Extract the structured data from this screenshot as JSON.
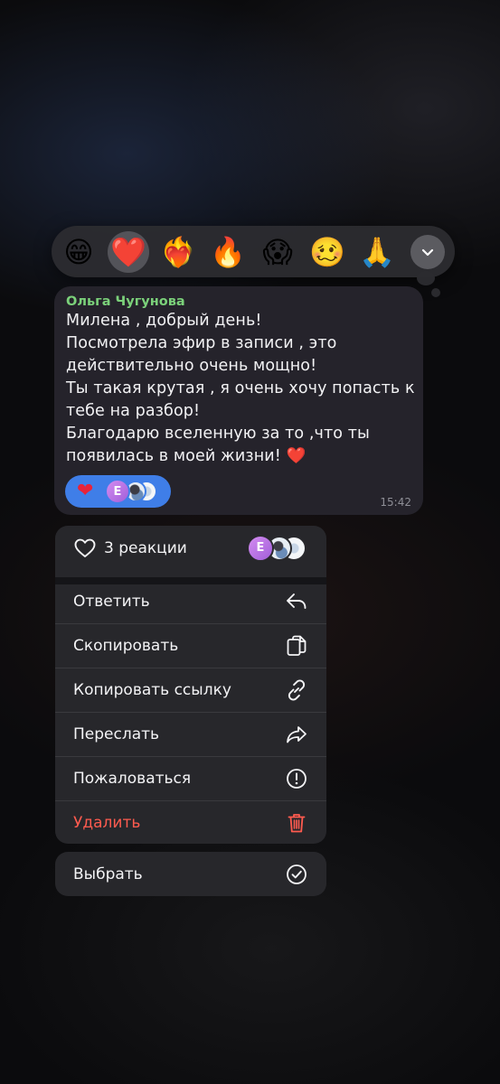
{
  "reaction_picker": {
    "emojis": [
      {
        "name": "grinning-face",
        "glyph": "😁"
      },
      {
        "name": "red-heart",
        "glyph": "❤️"
      },
      {
        "name": "heart-on-fire",
        "glyph": "❤️‍🔥"
      },
      {
        "name": "fire",
        "glyph": "🔥"
      },
      {
        "name": "face-screaming",
        "glyph": "😱"
      },
      {
        "name": "woozy-face",
        "glyph": "🥴"
      },
      {
        "name": "folded-hands",
        "glyph": "🙏"
      }
    ],
    "selected": "red-heart",
    "expand_icon": "chevron-down-icon"
  },
  "message": {
    "sender": "Ольга Чугунова",
    "sender_color": "#7bd17a",
    "lines": [
      "Милена , добрый день!",
      "Посмотрела эфир в записи , это",
      "действительно очень мощно!",
      "Ты такая крутая , я очень хочу попасть к",
      "тебе на разбор!",
      "Благодарю вселенную за то ,что ты",
      "появилась в моей жизни!"
    ],
    "trailing_emoji": "❤️",
    "time": "15:42",
    "reaction": {
      "glyph": "❤",
      "avatar_initial": "Е",
      "pill_color": "#3f7ee8"
    }
  },
  "menu": {
    "reactions_summary": {
      "icon": "heart-outline-icon",
      "label": "3 реакции",
      "avatar_initial": "Е"
    },
    "items": [
      {
        "label": "Ответить",
        "icon": "reply-icon"
      },
      {
        "label": "Скопировать",
        "icon": "copy-icon"
      },
      {
        "label": "Копировать ссылку",
        "icon": "link-icon"
      },
      {
        "label": "Переслать",
        "icon": "forward-icon"
      },
      {
        "label": "Пожаловаться",
        "icon": "report-icon"
      },
      {
        "label": "Удалить",
        "icon": "trash-icon",
        "danger": true
      }
    ],
    "select": {
      "label": "Выбрать",
      "icon": "checkmark-circle-icon"
    },
    "danger_color": "#ff5b4f"
  }
}
